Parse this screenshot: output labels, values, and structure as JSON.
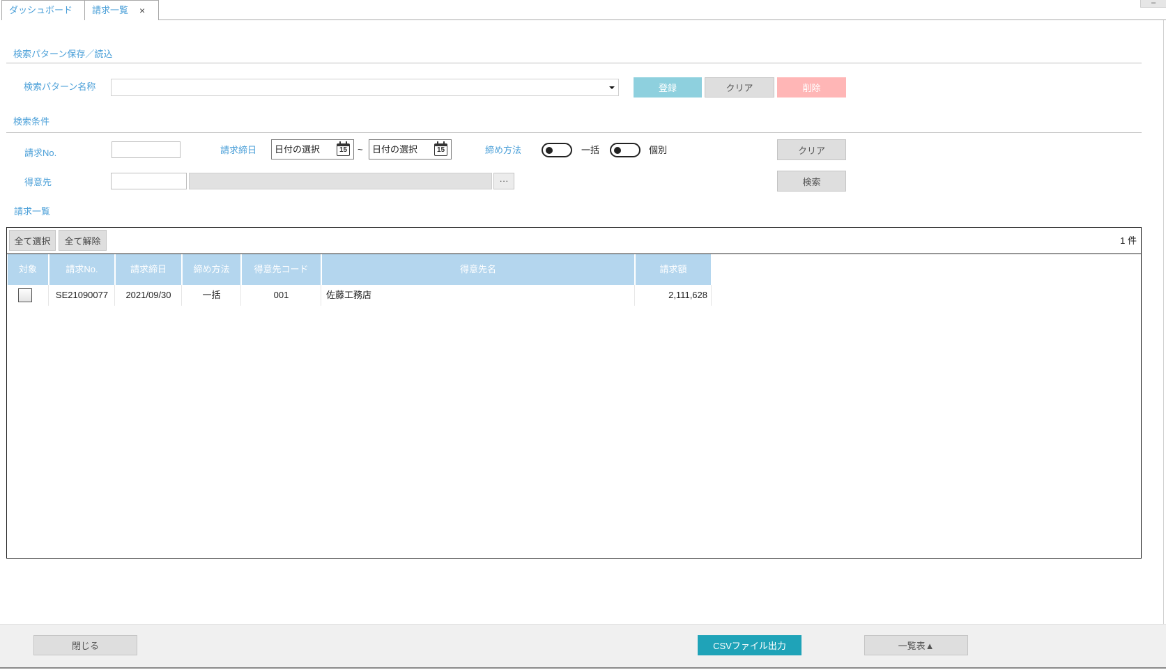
{
  "tabs": [
    {
      "label": "ダッシュボード"
    },
    {
      "label": "請求一覧",
      "close_glyph": "×"
    }
  ],
  "window": {
    "minimize_glyph": "–"
  },
  "pattern": {
    "title": "検索パターン保存／読込",
    "name_label": "検索パターン名称",
    "select_value": "",
    "register_label": "登録",
    "clear_label": "クリア",
    "delete_label": "削除"
  },
  "criteria": {
    "title": "検索条件",
    "invoice_no_label": "請求No.",
    "invoice_no_value": "",
    "closing_date_label": "請求締日",
    "date_from_placeholder": "日付の選択",
    "date_to_placeholder": "日付の選択",
    "range_sep": "~",
    "calendar_day": "15",
    "closing_method_label": "締め方法",
    "toggle_bulk_label": "一括",
    "toggle_bulk_on": false,
    "toggle_individual_label": "個別",
    "toggle_individual_on": false,
    "clear_label": "クリア",
    "customer_label": "得意先",
    "customer_code_value": "",
    "customer_name_value": "",
    "lookup_label": "···",
    "search_label": "検索"
  },
  "list": {
    "title": "請求一覧",
    "select_all_label": "全て選択",
    "deselect_all_label": "全て解除",
    "count_label": "1 件",
    "columns": [
      "対象",
      "請求No.",
      "請求締日",
      "締め方法",
      "得意先コード",
      "得意先名",
      "請求額"
    ],
    "rows": [
      {
        "checked": false,
        "invoice_no": "SE21090077",
        "closing_date": "2021/09/30",
        "method": "一括",
        "customer_code": "001",
        "customer_name": "佐藤工務店",
        "amount": "2,111,628"
      }
    ]
  },
  "footer": {
    "close_label": "閉じる",
    "csv_label": "CSVファイル出力",
    "list_label": "一覧表▲"
  },
  "icons": {
    "tab_close": "close-icon",
    "minimize": "minimize-icon",
    "dropdown": "chevron-down-icon",
    "calendar": "calendar-icon"
  },
  "colors": {
    "accent": "#4a9fd8",
    "header_bg": "#b4d6ee",
    "register": "#8ed0de",
    "delete": "#ffb6b6",
    "csv": "#1fa3b8",
    "button_gray": "#dedede"
  }
}
